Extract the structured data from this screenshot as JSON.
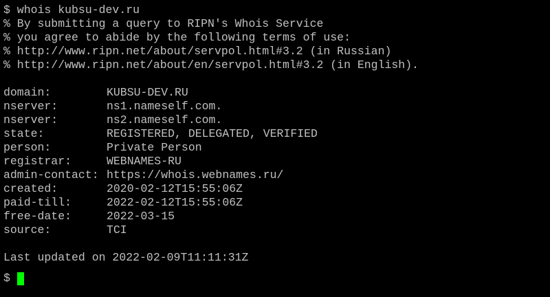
{
  "terminal": {
    "command_line": "$ whois kubsu-dev.ru",
    "comments": [
      "% By submitting a query to RIPN's Whois Service",
      "% you agree to abide by the following terms of use:",
      "% http://www.ripn.net/about/servpol.html#3.2 (in Russian)",
      "% http://www.ripn.net/about/en/servpol.html#3.2 (in English)."
    ],
    "fields": [
      {
        "key": "domain:",
        "value": "KUBSU-DEV.RU"
      },
      {
        "key": "nserver:",
        "value": "ns1.nameself.com."
      },
      {
        "key": "nserver:",
        "value": "ns2.nameself.com."
      },
      {
        "key": "state:",
        "value": "REGISTERED, DELEGATED, VERIFIED"
      },
      {
        "key": "person:",
        "value": "Private Person"
      },
      {
        "key": "registrar:",
        "value": "WEBNAMES-RU"
      },
      {
        "key": "admin-contact:",
        "value": "https://whois.webnames.ru/"
      },
      {
        "key": "created:",
        "value": "2020-02-12T15:55:06Z"
      },
      {
        "key": "paid-till:",
        "value": "2022-02-12T15:55:06Z"
      },
      {
        "key": "free-date:",
        "value": "2022-03-15"
      },
      {
        "key": "source:",
        "value": "TCI"
      }
    ],
    "last_updated": "Last updated on 2022-02-09T11:11:31Z",
    "prompt": "$",
    "colors": {
      "background": "#000000",
      "text": "#c0c0c0",
      "cursor": "#00ff00"
    }
  }
}
